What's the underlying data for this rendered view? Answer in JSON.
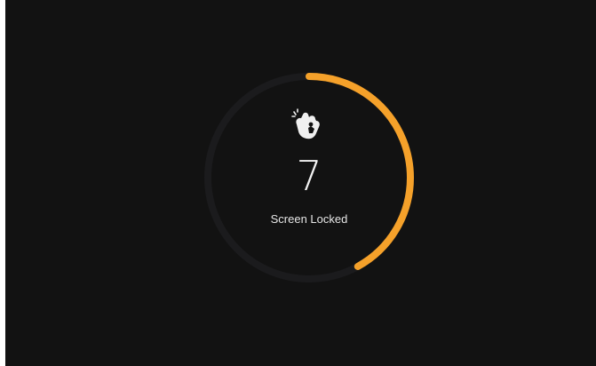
{
  "screen": {
    "background_color": "#121212"
  },
  "lock_timer": {
    "countdown_value": "7",
    "status_label": "Screen Locked",
    "progress_fraction": 0.42,
    "accent_color": "#f5a12a",
    "track_color": "#1b1b1d",
    "icon": "touch-gesture-icon"
  }
}
